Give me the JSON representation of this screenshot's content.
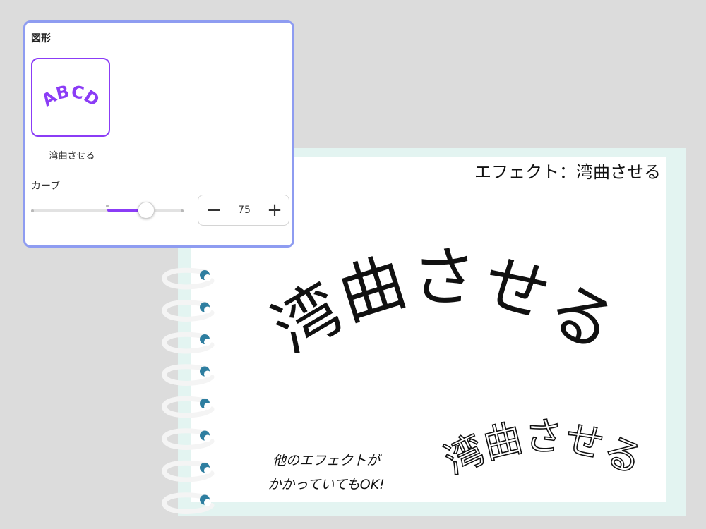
{
  "panel": {
    "title": "図形",
    "effect": {
      "preview_text": "ABCD",
      "label": "湾曲させる"
    },
    "curve": {
      "label": "カーブ",
      "value": 75,
      "slider_level_percent": 75
    },
    "stepper": {
      "minus": "−",
      "value": "75",
      "plus": "+"
    }
  },
  "notebook": {
    "header": "エフェクト：湾曲させる",
    "curved_text_main": "湾曲させる",
    "curved_text_outline": "湾曲させる",
    "note_lines": [
      "他のエフェクトが",
      "かかっていてもOK!"
    ]
  },
  "colors": {
    "accent": "#8b3cf6",
    "panel_border": "#8e9cf1",
    "notebook_back": "#e3f4f1",
    "ring_hole": "#2e7ea0"
  }
}
